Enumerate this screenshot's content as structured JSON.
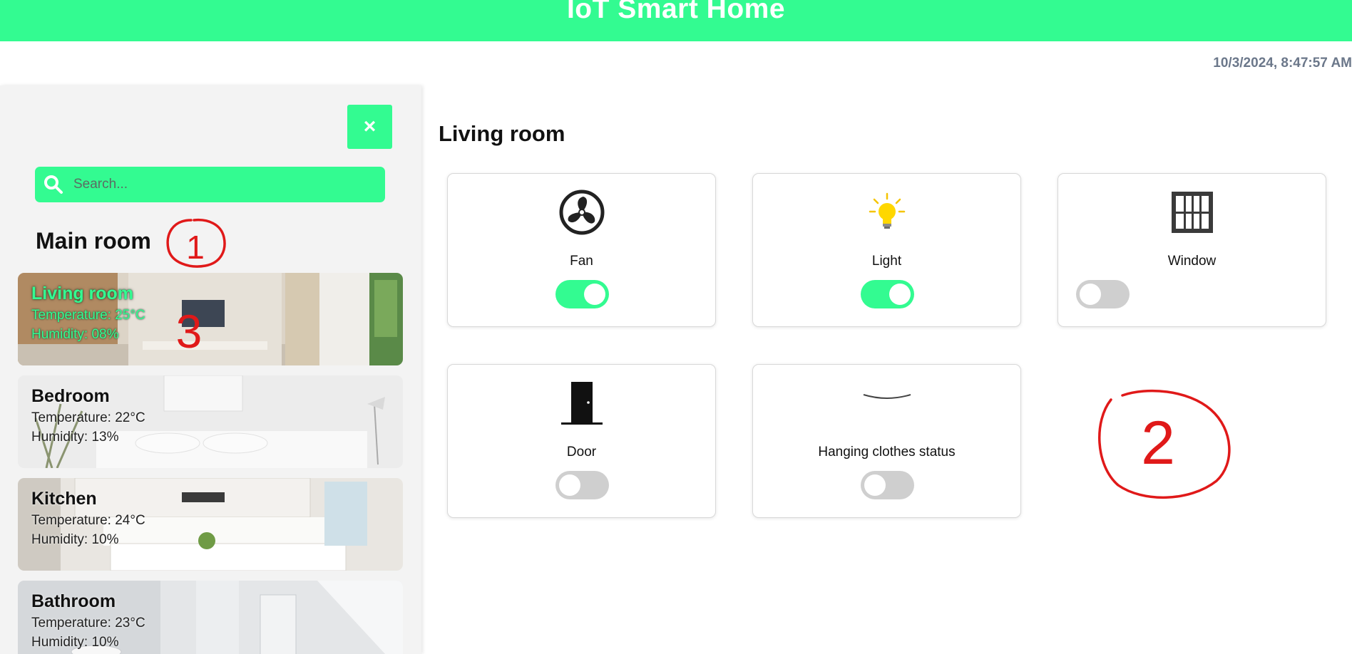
{
  "app": {
    "title": "IoT Smart Home",
    "datetime": "10/3/2024, 8:47:57 AM"
  },
  "sidebar": {
    "close_label": "×",
    "search": {
      "placeholder": "Search...",
      "value": ""
    },
    "section_title": "Main room",
    "rooms": [
      {
        "name": "Living room",
        "temperature": "Temperature: 25°C",
        "humidity": "Humidity: 08%",
        "active": true
      },
      {
        "name": "Bedroom",
        "temperature": "Temperature: 22°C",
        "humidity": "Humidity: 13%",
        "active": false
      },
      {
        "name": "Kitchen",
        "temperature": "Temperature: 24°C",
        "humidity": "Humidity: 10%",
        "active": false
      },
      {
        "name": "Bathroom",
        "temperature": "Temperature: 23°C",
        "humidity": "Humidity: 10%",
        "active": false
      }
    ]
  },
  "main": {
    "room_title": "Living room",
    "devices": [
      {
        "name": "Fan",
        "icon": "fan-icon",
        "on": true
      },
      {
        "name": "Light",
        "icon": "lightbulb-icon",
        "on": true
      },
      {
        "name": "Window",
        "icon": "window-icon",
        "on": false
      },
      {
        "name": "Door",
        "icon": "door-icon",
        "on": false
      },
      {
        "name": "Hanging clothes status",
        "icon": "clothes-hanger-icon",
        "on": false
      }
    ]
  },
  "annotations": [
    "1",
    "2",
    "3"
  ],
  "colors": {
    "accent": "#33fb91",
    "toggle_off": "#cfcfcf",
    "datetime_text": "#6b778a",
    "annotation": "#e01919"
  }
}
